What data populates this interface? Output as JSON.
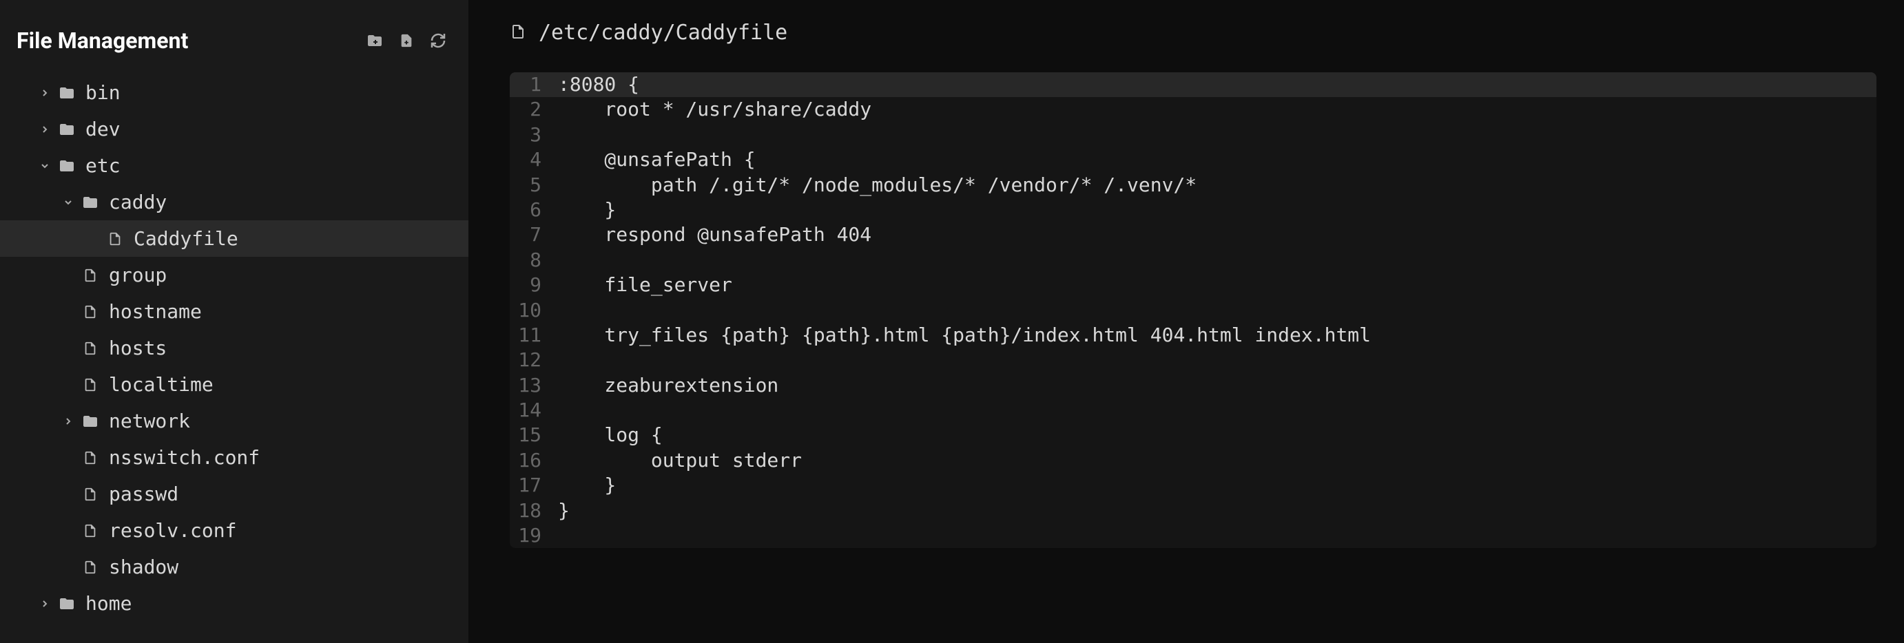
{
  "sidebar": {
    "title": "File Management",
    "tree": [
      {
        "label": "bin",
        "type": "folder",
        "expanded": false,
        "indent": 0,
        "hasChevron": true
      },
      {
        "label": "dev",
        "type": "folder",
        "expanded": false,
        "indent": 0,
        "hasChevron": true
      },
      {
        "label": "etc",
        "type": "folder",
        "expanded": true,
        "indent": 0,
        "hasChevron": true
      },
      {
        "label": "caddy",
        "type": "folder",
        "expanded": true,
        "indent": 1,
        "hasChevron": true
      },
      {
        "label": "Caddyfile",
        "type": "file",
        "indent": 2,
        "selected": true,
        "hasChevron": false
      },
      {
        "label": "group",
        "type": "file",
        "indent": 1,
        "hasChevron": false
      },
      {
        "label": "hostname",
        "type": "file",
        "indent": 1,
        "hasChevron": false
      },
      {
        "label": "hosts",
        "type": "file",
        "indent": 1,
        "hasChevron": false
      },
      {
        "label": "localtime",
        "type": "file",
        "indent": 1,
        "hasChevron": false
      },
      {
        "label": "network",
        "type": "folder",
        "expanded": false,
        "indent": 1,
        "hasChevron": true
      },
      {
        "label": "nsswitch.conf",
        "type": "file",
        "indent": 1,
        "hasChevron": false
      },
      {
        "label": "passwd",
        "type": "file",
        "indent": 1,
        "hasChevron": false
      },
      {
        "label": "resolv.conf",
        "type": "file",
        "indent": 1,
        "hasChevron": false
      },
      {
        "label": "shadow",
        "type": "file",
        "indent": 1,
        "hasChevron": false
      },
      {
        "label": "home",
        "type": "folder",
        "expanded": false,
        "indent": 0,
        "hasChevron": true
      }
    ]
  },
  "editor": {
    "filePath": "/etc/caddy/Caddyfile",
    "activeLine": 1,
    "lines": [
      ":8080 {",
      "    root * /usr/share/caddy",
      "",
      "    @unsafePath {",
      "        path /.git/* /node_modules/* /vendor/* /.venv/*",
      "    }",
      "    respond @unsafePath 404",
      "",
      "    file_server",
      "",
      "    try_files {path} {path}.html {path}/index.html 404.html index.html",
      "",
      "    zeaburextension",
      "",
      "    log {",
      "        output stderr",
      "    }",
      "}",
      ""
    ]
  }
}
